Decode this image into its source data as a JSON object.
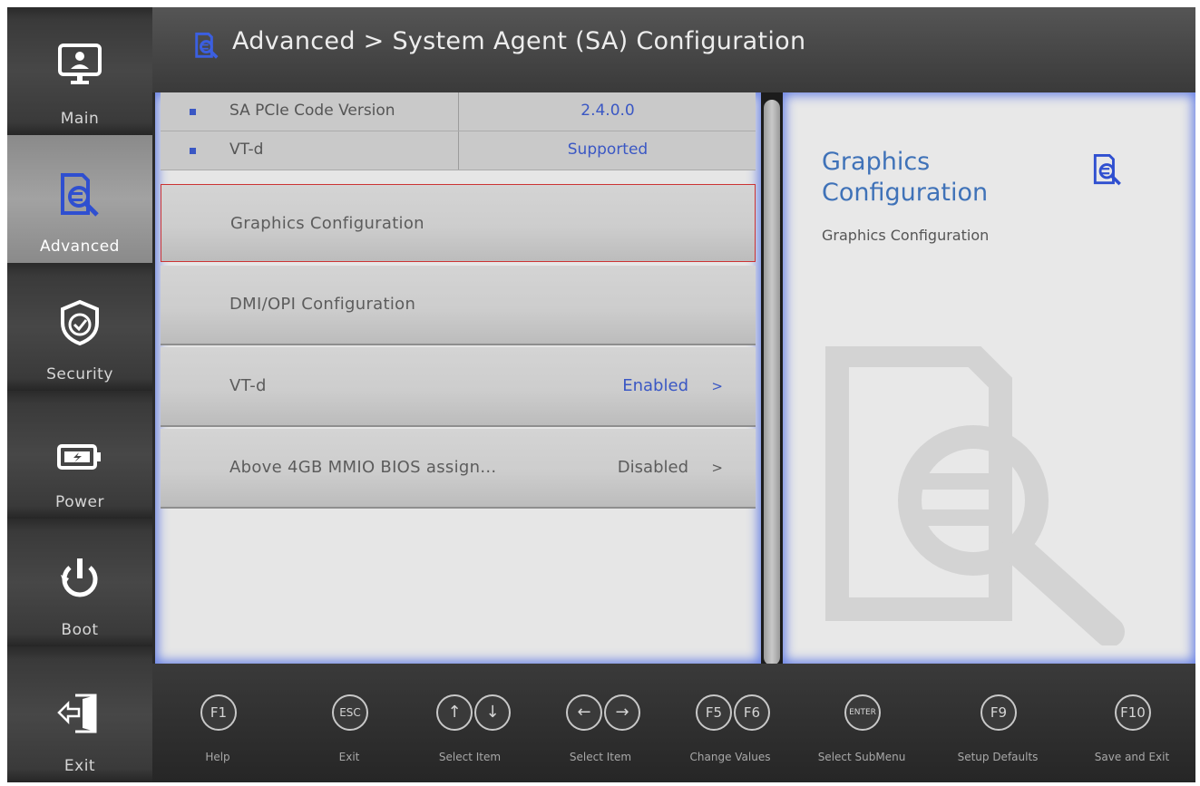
{
  "header": {
    "title": "Advanced > System Agent (SA) Configuration",
    "icon": "document-search-icon"
  },
  "sidebar": {
    "items": [
      {
        "label": "Main",
        "icon": "monitor-user-icon"
      },
      {
        "label": "Advanced",
        "icon": "document-search-icon"
      },
      {
        "label": "Security",
        "icon": "shield-check-icon"
      },
      {
        "label": "Power",
        "icon": "battery-icon"
      },
      {
        "label": "Boot",
        "icon": "power-icon"
      },
      {
        "label": "Exit",
        "icon": "exit-door-icon"
      }
    ],
    "active": "Advanced"
  },
  "info": [
    {
      "label": "SA PCIe Code Version",
      "value": "2.4.0.0"
    },
    {
      "label": "VT-d",
      "value": "Supported"
    }
  ],
  "menu": [
    {
      "label": "Graphics Configuration",
      "value": "",
      "chevron": ""
    },
    {
      "label": "DMI/OPI Configuration",
      "value": "",
      "chevron": ""
    },
    {
      "label": "VT-d",
      "value": "Enabled",
      "chevron": ">"
    },
    {
      "label": "Above 4GB MMIO BIOS assign...",
      "value": "Disabled",
      "chevron": ">"
    }
  ],
  "help": {
    "title": "Graphics Configuration",
    "description": "Graphics Configuration",
    "icon": "document-search-icon"
  },
  "footer": {
    "keys": [
      {
        "keys": [
          "F1"
        ],
        "label": "Help"
      },
      {
        "keys": [
          "ESC"
        ],
        "label": "Exit"
      },
      {
        "keys": [
          "↑",
          "↓"
        ],
        "label": "Select Item"
      },
      {
        "keys": [
          "←",
          "→"
        ],
        "label": "Select Item"
      },
      {
        "keys": [
          "F5",
          "F6"
        ],
        "label": "Change Values"
      },
      {
        "keys": [
          "ENTER"
        ],
        "label": "Select SubMenu"
      },
      {
        "keys": [
          "F9"
        ],
        "label": "Setup Defaults"
      },
      {
        "keys": [
          "F10"
        ],
        "label": "Save and Exit"
      }
    ]
  },
  "colors": {
    "accent_blue": "#3a57c4",
    "help_title_blue": "#3f72b8",
    "glow_blue": "#506ee6",
    "selection_red": "#cc3333"
  }
}
